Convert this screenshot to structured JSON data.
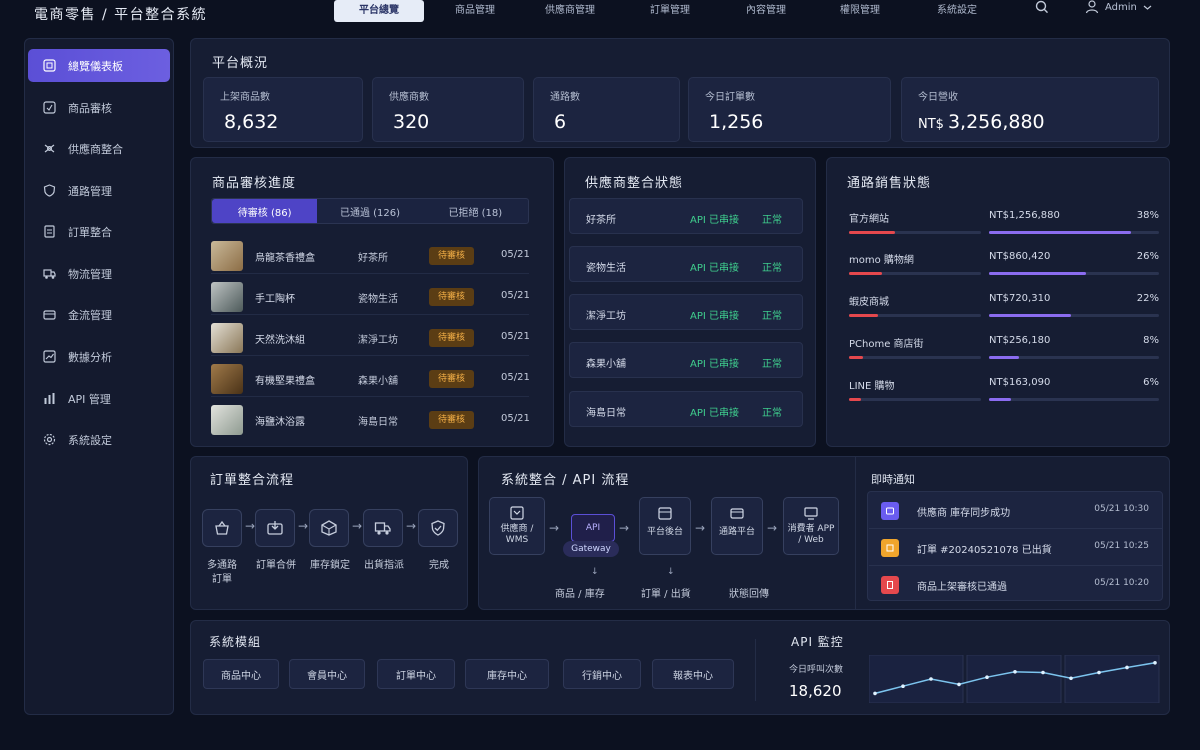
{
  "app": {
    "brand": "電商零售 / 平台整合系統"
  },
  "nav": {
    "items": [
      "平台總覽",
      "商品管理",
      "供應商管理",
      "訂單管理",
      "內容管理",
      "權限管理",
      "系統設定"
    ],
    "user": "Admin"
  },
  "sidebar": {
    "items": [
      "總覽儀表板",
      "商品審核",
      "供應商整合",
      "通路管理",
      "訂單整合",
      "物流管理",
      "金流管理",
      "數據分析",
      "API 管理",
      "系統設定"
    ]
  },
  "overview": {
    "title": "平台概況",
    "stats": [
      {
        "label": "上架商品數",
        "value": "8,632",
        "prefix": ""
      },
      {
        "label": "供應商數",
        "value": "320",
        "prefix": ""
      },
      {
        "label": "通路數",
        "value": "6",
        "prefix": ""
      },
      {
        "label": "今日訂單數",
        "value": "1,256",
        "prefix": ""
      },
      {
        "label": "今日營收",
        "value": "3,256,880",
        "prefix": "NT$"
      }
    ]
  },
  "review": {
    "title": "商品審核進度",
    "tabs": [
      "待審核 (86)",
      "已通過 (126)",
      "已拒絕 (18)"
    ],
    "rows": [
      {
        "name": "烏龍茶香禮盒",
        "supplier": "好茶所",
        "status": "待審核",
        "date": "05/21"
      },
      {
        "name": "手工陶杯",
        "supplier": "瓷物生活",
        "status": "待審核",
        "date": "05/21"
      },
      {
        "name": "天然洗沐組",
        "supplier": "潔淨工坊",
        "status": "待審核",
        "date": "05/21"
      },
      {
        "name": "有機堅果禮盒",
        "supplier": "森果小舖",
        "status": "待審核",
        "date": "05/21"
      },
      {
        "name": "海鹽沐浴露",
        "supplier": "海島日常",
        "status": "待審核",
        "date": "05/21"
      }
    ]
  },
  "suppliers": {
    "title": "供應商整合狀態",
    "rows": [
      {
        "name": "好茶所",
        "api": "API 已串接",
        "status": "正常"
      },
      {
        "name": "瓷物生活",
        "api": "API 已串接",
        "status": "正常"
      },
      {
        "name": "潔淨工坊",
        "api": "API 已串接",
        "status": "正常"
      },
      {
        "name": "森果小舖",
        "api": "API 已串接",
        "status": "正常"
      },
      {
        "name": "海島日常",
        "api": "API 已串接",
        "status": "正常"
      }
    ]
  },
  "channels": {
    "title": "通路銷售狀態",
    "rows": [
      {
        "name": "官方網站",
        "amount": "NT$1,256,880",
        "pct": "38%",
        "share": 0.38
      },
      {
        "name": "momo 購物網",
        "amount": "NT$860,420",
        "pct": "26%",
        "share": 0.26
      },
      {
        "name": "蝦皮商城",
        "amount": "NT$720,310",
        "pct": "22%",
        "share": 0.22
      },
      {
        "name": "PChome 商店街",
        "amount": "NT$256,180",
        "pct": "8%",
        "share": 0.08
      },
      {
        "name": "LINE 購物",
        "amount": "NT$163,090",
        "pct": "6%",
        "share": 0.06
      }
    ]
  },
  "order_flow": {
    "title": "訂單整合流程",
    "steps": [
      "多通路\n訂單",
      "訂單合併",
      "庫存鎖定",
      "出貨指派",
      "完成"
    ]
  },
  "api_flow": {
    "title": "系統整合 / API 流程",
    "nodes": [
      "供應商 / WMS",
      "API",
      "Gateway",
      "平台後台",
      "通路平台",
      "消費者 APP / Web"
    ],
    "sub_labels": [
      "商品 / 庫存",
      "訂單 / 出貨",
      "狀態回傳"
    ]
  },
  "notifications": {
    "title": "即時通知",
    "items": [
      {
        "text": "供應商 庫存同步成功",
        "time": "05/21 10:30",
        "color": "#6a5cf0"
      },
      {
        "text": "訂單 #20240521078 已出貨",
        "time": "05/21 10:25",
        "color": "#f0a52c"
      },
      {
        "text": "商品上架審核已通過",
        "time": "05/21 10:20",
        "color": "#e5484d"
      }
    ]
  },
  "modules": {
    "title": "系統模組",
    "items": [
      "商品中心",
      "會員中心",
      "訂單中心",
      "庫存中心",
      "行銷中心",
      "報表中心"
    ]
  },
  "api_monitor": {
    "title": "API 監控",
    "label": "今日呼叫次數",
    "value": "18,620"
  },
  "chart_data": {
    "type": "line",
    "title": "",
    "x": [
      1,
      2,
      3,
      4,
      5,
      6,
      7,
      8,
      9,
      10,
      11
    ],
    "series": [
      {
        "values": [
          10,
          30,
          50,
          35,
          55,
          70,
          68,
          52,
          68,
          82,
          95
        ]
      }
    ],
    "ylim": [
      0,
      100
    ],
    "grid": true
  },
  "colors": {
    "accent": "#5b4fd6",
    "success": "#3fcf8e",
    "warning": "#f2ae46",
    "channel_bar_low": "#e5484d",
    "channel_bar_share": "#8b6cf0"
  }
}
